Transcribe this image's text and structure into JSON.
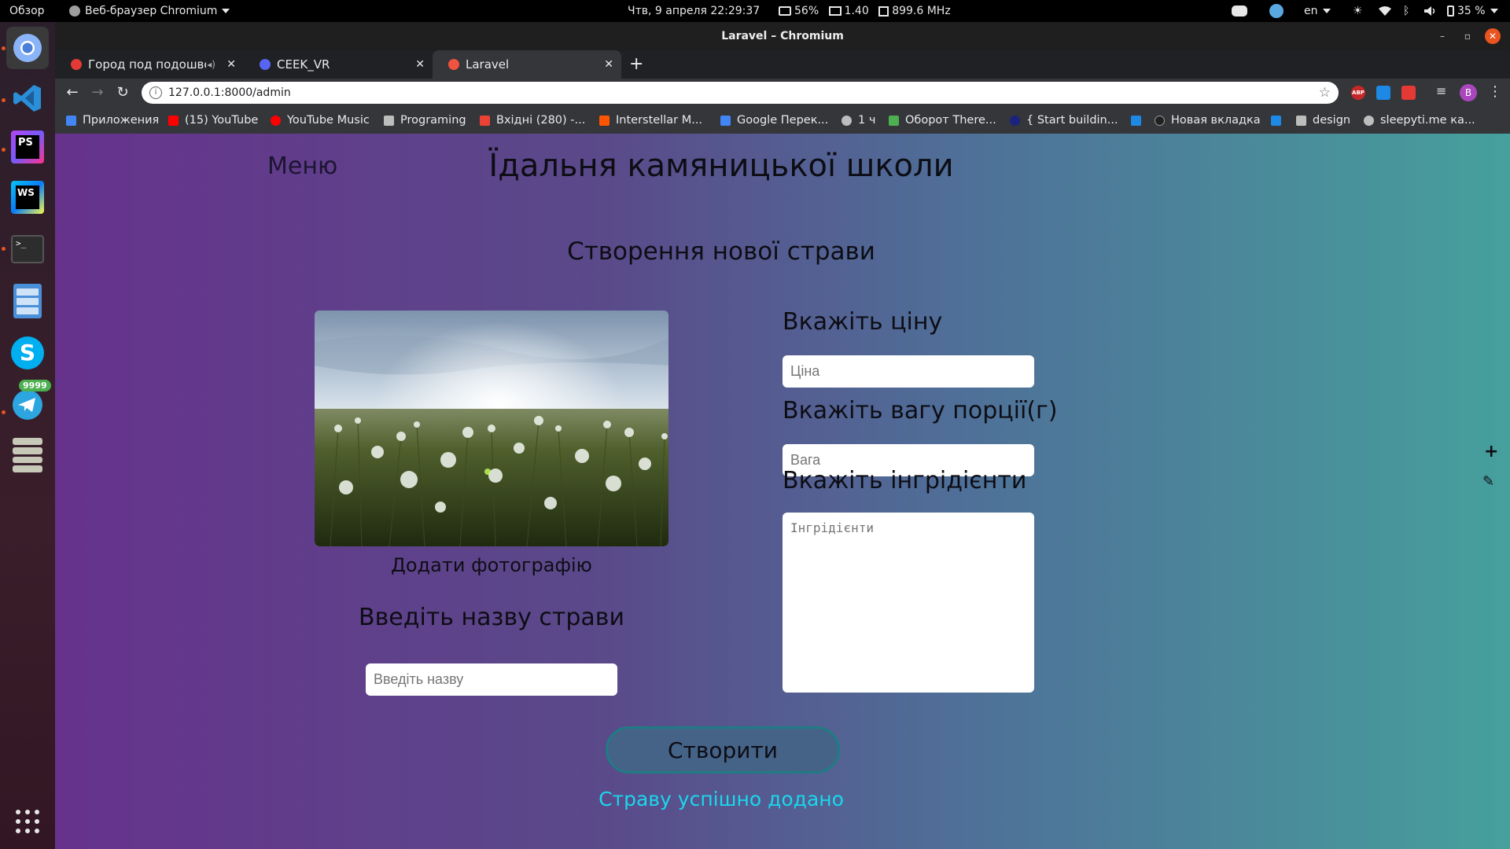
{
  "topbar": {
    "activities": "Обзор",
    "app_menu": "Веб-браузер Chromium",
    "clock": "Чтв, 9 апреля  22:29:37",
    "battery_widget": "56%",
    "load": "1.40",
    "cpu_freq": "899.6 MHz",
    "lang": "en",
    "battery_percent": "35 %"
  },
  "dock": {
    "telegram_badge": "9999"
  },
  "window": {
    "title": "Laravel – Chromium"
  },
  "tabs": [
    {
      "label": "Город под подошвой",
      "favicon_color": "#e53935"
    },
    {
      "label": "CEEK_VR",
      "favicon_color": "#5865f2"
    },
    {
      "label": "Laravel",
      "favicon_color": "#f05340"
    }
  ],
  "address_bar": {
    "url": "127.0.0.1:8000/admin"
  },
  "bookmarks": [
    {
      "label": "Приложения",
      "color": "#4285f4"
    },
    {
      "label": "(15) YouTube",
      "color": "#ff0000"
    },
    {
      "label": "YouTube Music",
      "color": "#ff0000"
    },
    {
      "label": "Programing",
      "color": "#bdbdbd"
    },
    {
      "label": "Вхідні (280) -...",
      "color": "#ea4335"
    },
    {
      "label": "Interstellar M...",
      "color": "#ff5500"
    },
    {
      "label": "Google Перек...",
      "color": "#4285f4"
    },
    {
      "label": "1 ч",
      "color": "#bdbdbd"
    },
    {
      "label": "Оборот There...",
      "color": "#4caf50"
    },
    {
      "label": "{ Start buildin...",
      "color": "#1a237e"
    },
    {
      "label": "",
      "color": "#1e88e5"
    },
    {
      "label": "Новая вкладка",
      "color": "#212121"
    },
    {
      "label": "",
      "color": "#1e88e5"
    },
    {
      "label": "design",
      "color": "#bdbdbd"
    },
    {
      "label": "sleepyti.me ка...",
      "color": "#bdbdbd"
    }
  ],
  "page": {
    "menu_label": "Меню",
    "site_title": "Їдальня камяницької школи",
    "form_title": "Створення нової страви",
    "photo_caption": "Додати фотографію",
    "name_label": "Введіть назву страви",
    "name_placeholder": "Введіть назву",
    "price_label": "Вкажіть ціну",
    "price_placeholder": "Ціна",
    "weight_label": "Вкажіть вагу порції(г)",
    "weight_placeholder": "Вага",
    "ingredients_label": "Вкажіть інгрідієнти",
    "ingredients_placeholder": "Інгрідієнти",
    "create_button": "Створити",
    "success_message": "Страву успішно додано"
  },
  "colors": {
    "accent_success": "#19d8ec",
    "page_gradient_start": "#66328c",
    "page_gradient_end": "#46a09c"
  }
}
